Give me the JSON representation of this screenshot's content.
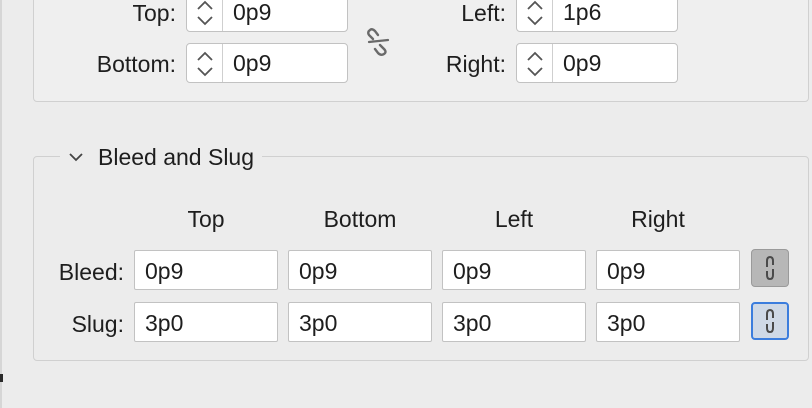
{
  "margins": {
    "top": {
      "label": "Top:",
      "value": "0p9"
    },
    "bottom": {
      "label": "Bottom:",
      "value": "0p9"
    },
    "left": {
      "label": "Left:",
      "value": "1p6"
    },
    "right": {
      "label": "Right:",
      "value": "0p9"
    },
    "link_icon": "broken-chain-icon"
  },
  "bleed_slug": {
    "title": "Bleed and Slug",
    "columns": [
      "Top",
      "Bottom",
      "Left",
      "Right"
    ],
    "bleed": {
      "label": "Bleed:",
      "values": [
        "0p9",
        "0p9",
        "0p9",
        "0p9"
      ],
      "link_active": false
    },
    "slug": {
      "label": "Slug:",
      "values": [
        "3p0",
        "3p0",
        "3p0",
        "3p0"
      ],
      "link_active": true
    }
  },
  "colors": {
    "focus_accent": "#3b7ddd",
    "panel_bg": "#ececec"
  }
}
